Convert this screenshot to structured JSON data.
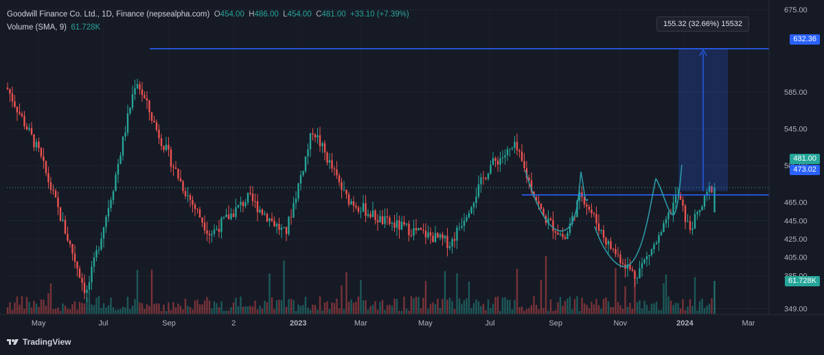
{
  "legend": {
    "title": "Goodwill Finance Co. Ltd., 1D, Finance (nepsealpha.com)",
    "open_label": "O",
    "open": "454.00",
    "high_label": "H",
    "high": "486.00",
    "low_label": "L",
    "low": "454.00",
    "close_label": "C",
    "close": "481.00",
    "change": "+33.10 (+7.39%)",
    "volume_label": "Volume (SMA, 9)",
    "volume_value": "61.728K"
  },
  "measure_tooltip": "155.32 (32.66%) 15532",
  "badges": {
    "top_level": "632.36",
    "current_price": "481.00",
    "breakout_level": "473.02",
    "volume": "61.728K"
  },
  "brand": "TradingView",
  "colors": {
    "background": "#161a25",
    "up": "#26a69a",
    "down": "#ef5350",
    "drawing_line": "#2962ff",
    "pattern_curve": "#2b9aa7",
    "axis_text": "#b2b5be"
  },
  "chart_data": {
    "type": "candlestick",
    "y_axis_ticks": [
      675,
      585,
      545,
      505,
      465,
      445,
      425,
      405,
      385,
      349
    ],
    "y_range": [
      340,
      680
    ],
    "x_axis_ticks": [
      "May",
      "Jul",
      "Sep",
      "2",
      "2023",
      "Mar",
      "May",
      "Jul",
      "Sep",
      "Nov",
      "2024",
      "Mar"
    ],
    "last_bar": {
      "open": 454.0,
      "high": 486.0,
      "low": 454.0,
      "close": 481.0
    },
    "levels": {
      "top_horizontal": 632.36,
      "breakout_horizontal": 473.02,
      "current_price": 481.0
    },
    "measure": {
      "from": 477.04,
      "to": 632.36,
      "change": 155.32,
      "percent": 32.66,
      "bars": 15532
    },
    "patterns": [
      "cup-and-handle",
      "cup-and-handle"
    ],
    "price_path_approx": [
      {
        "date": "2022-04",
        "close": 590
      },
      {
        "date": "2022-05",
        "close": 520
      },
      {
        "date": "2022-06-15",
        "close": 365
      },
      {
        "date": "2022-07-10",
        "close": 480
      },
      {
        "date": "2022-08-01",
        "close": 600
      },
      {
        "date": "2022-08-20",
        "close": 545
      },
      {
        "date": "2022-09-15",
        "close": 480
      },
      {
        "date": "2022-10-10",
        "close": 430
      },
      {
        "date": "2022-11-15",
        "close": 470
      },
      {
        "date": "2022-12-20",
        "close": 430
      },
      {
        "date": "2023-01-15",
        "close": 545
      },
      {
        "date": "2023-02-15",
        "close": 470
      },
      {
        "date": "2023-03-20",
        "close": 445
      },
      {
        "date": "2023-05-01",
        "close": 430
      },
      {
        "date": "2023-05-25",
        "close": 420
      },
      {
        "date": "2023-07-01",
        "close": 505
      },
      {
        "date": "2023-07-25",
        "close": 525
      },
      {
        "date": "2023-08-20",
        "close": 450
      },
      {
        "date": "2023-09-10",
        "close": 425
      },
      {
        "date": "2023-09-25",
        "close": 475
      },
      {
        "date": "2023-10-20",
        "close": 420
      },
      {
        "date": "2023-11-15",
        "close": 385
      },
      {
        "date": "2023-12-10",
        "close": 430
      },
      {
        "date": "2023-12-25",
        "close": 475
      },
      {
        "date": "2024-01-05",
        "close": 435
      },
      {
        "date": "2024-01-15",
        "close": 455
      },
      {
        "date": "2024-01-25",
        "close": 481
      }
    ]
  }
}
